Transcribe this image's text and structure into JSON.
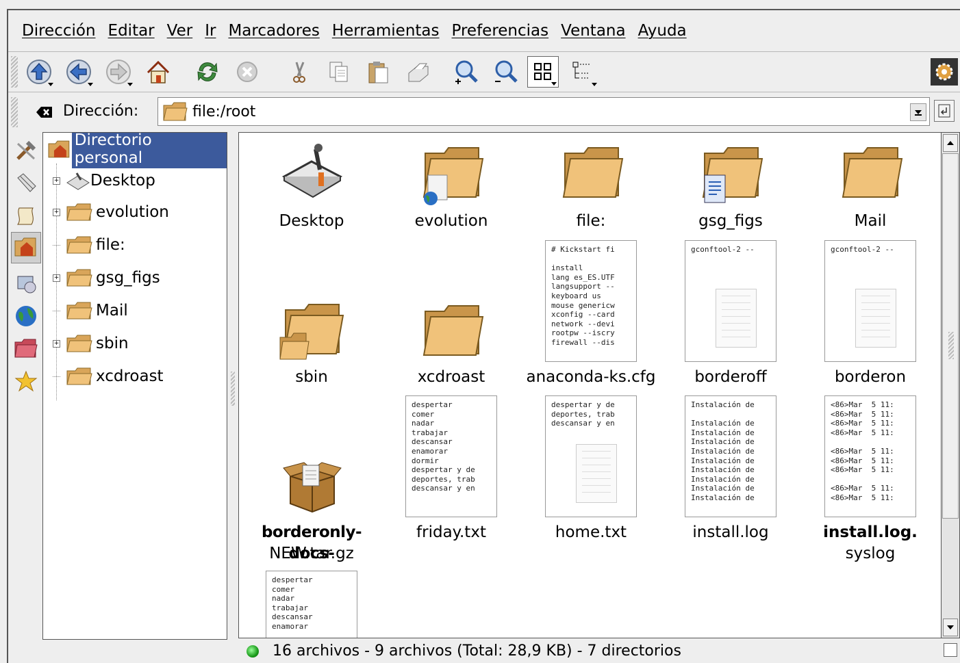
{
  "menu": {
    "items": [
      "Dirección",
      "Editar",
      "Ver",
      "Ir",
      "Marcadores",
      "Herramientas",
      "Preferencias",
      "Ventana",
      "Ayuda"
    ]
  },
  "toolbar": {
    "buttons": [
      "up-icon",
      "back-icon",
      "forward-icon",
      "home-icon",
      "reload-icon",
      "stop-icon",
      "cut-icon",
      "copy-icon",
      "paste-icon",
      "print-icon",
      "zoom-in-icon",
      "zoom-out-icon",
      "icon-view-icon",
      "tree-view-icon",
      "konqueror-gear-icon"
    ]
  },
  "location": {
    "label": "Dirección:",
    "value": "file:/root"
  },
  "tree": {
    "root": "Directorio personal",
    "items": [
      {
        "label": "Desktop",
        "expandable": true
      },
      {
        "label": "evolution",
        "expandable": true
      },
      {
        "label": "file:",
        "expandable": false
      },
      {
        "label": "gsg_figs",
        "expandable": true
      },
      {
        "label": "Mail",
        "expandable": false
      },
      {
        "label": "sbin",
        "expandable": true
      },
      {
        "label": "xcdroast",
        "expandable": false
      }
    ]
  },
  "files": [
    {
      "name": "Desktop",
      "kind": "desktop"
    },
    {
      "name": "evolution",
      "kind": "folder-globe"
    },
    {
      "name": "file:",
      "kind": "folder"
    },
    {
      "name": "gsg_figs",
      "kind": "folder-doc"
    },
    {
      "name": "Mail",
      "kind": "folder"
    },
    {
      "name": "sbin",
      "kind": "folder-sub"
    },
    {
      "name": "xcdroast",
      "kind": "folder"
    },
    {
      "name": "anaconda-ks.cfg",
      "kind": "text",
      "preview": "# Kickstart fi\n\ninstall\nlang es_ES.UTF\nlangsupport --\nkeyboard us\nmouse genericw\nxconfig --card\nnetwork --devi\nrootpw --iscry\nfirewall --dis"
    },
    {
      "name": "borderoff",
      "kind": "text-page",
      "preview": "gconftool-2 --"
    },
    {
      "name": "borderon",
      "kind": "text-page",
      "preview": "gconftool-2 --"
    },
    {
      "name": "borderonly-docs-",
      "name2": "NEW.tar.gz",
      "kind": "package"
    },
    {
      "name": "friday.txt",
      "kind": "text",
      "preview": "despertar\ncomer\nnadar\ntrabajar\ndescansar\nenamorar\ndormir\ndespertar y de\ndeportes, trab\ndescansar y en"
    },
    {
      "name": "home.txt",
      "kind": "text-page",
      "preview": "despertar y de\ndeportes, trab\ndescansar y en"
    },
    {
      "name": "install.log",
      "kind": "text",
      "preview": "Instalación de\n\nInstalación de\nInstalación de\nInstalación de\nInstalación de\nInstalación de\nInstalación de\nInstalación de\nInstalación de\nInstalación de"
    },
    {
      "name": "install.log.",
      "name2": "syslog",
      "kind": "text",
      "preview": "<86>Mar  5 11:\n<86>Mar  5 11:\n<86>Mar  5 11:\n<86>Mar  5 11:\n\n<86>Mar  5 11:\n<86>Mar  5 11:\n<86>Mar  5 11:\n\n<86>Mar  5 11:\n<86>Mar  5 11:"
    },
    {
      "name": "",
      "kind": "text",
      "preview": "despertar\ncomer\nnadar\ntrabajar\ndescansar\nenamorar"
    }
  ],
  "status": {
    "text": "16 archivos - 9 archivos (Total: 28,9 KB) - 7 directorios"
  },
  "colors": {
    "selection": "#3c5a9c",
    "folder": "#e8b56a",
    "background": "#eeeeee"
  }
}
